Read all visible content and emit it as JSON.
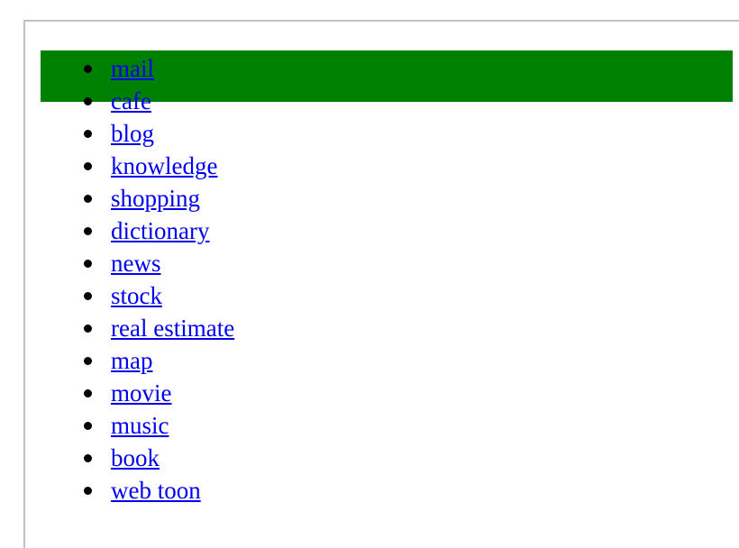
{
  "page": {
    "background_color": "#ffffff",
    "frame_border_color": "#c0c0c0"
  },
  "highlight": {
    "color": "#008000",
    "covers_items": [
      "mail",
      "cafe"
    ],
    "label": "selection-highlight"
  },
  "nav": {
    "link_color": "#0000ee",
    "bullet_color": "#000000",
    "items": [
      {
        "label": "mail"
      },
      {
        "label": "cafe"
      },
      {
        "label": "blog"
      },
      {
        "label": "knowledge"
      },
      {
        "label": "shopping"
      },
      {
        "label": "dictionary"
      },
      {
        "label": "news"
      },
      {
        "label": "stock"
      },
      {
        "label": "real estimate"
      },
      {
        "label": "map"
      },
      {
        "label": "movie"
      },
      {
        "label": "music"
      },
      {
        "label": "book"
      },
      {
        "label": "web toon"
      }
    ]
  }
}
